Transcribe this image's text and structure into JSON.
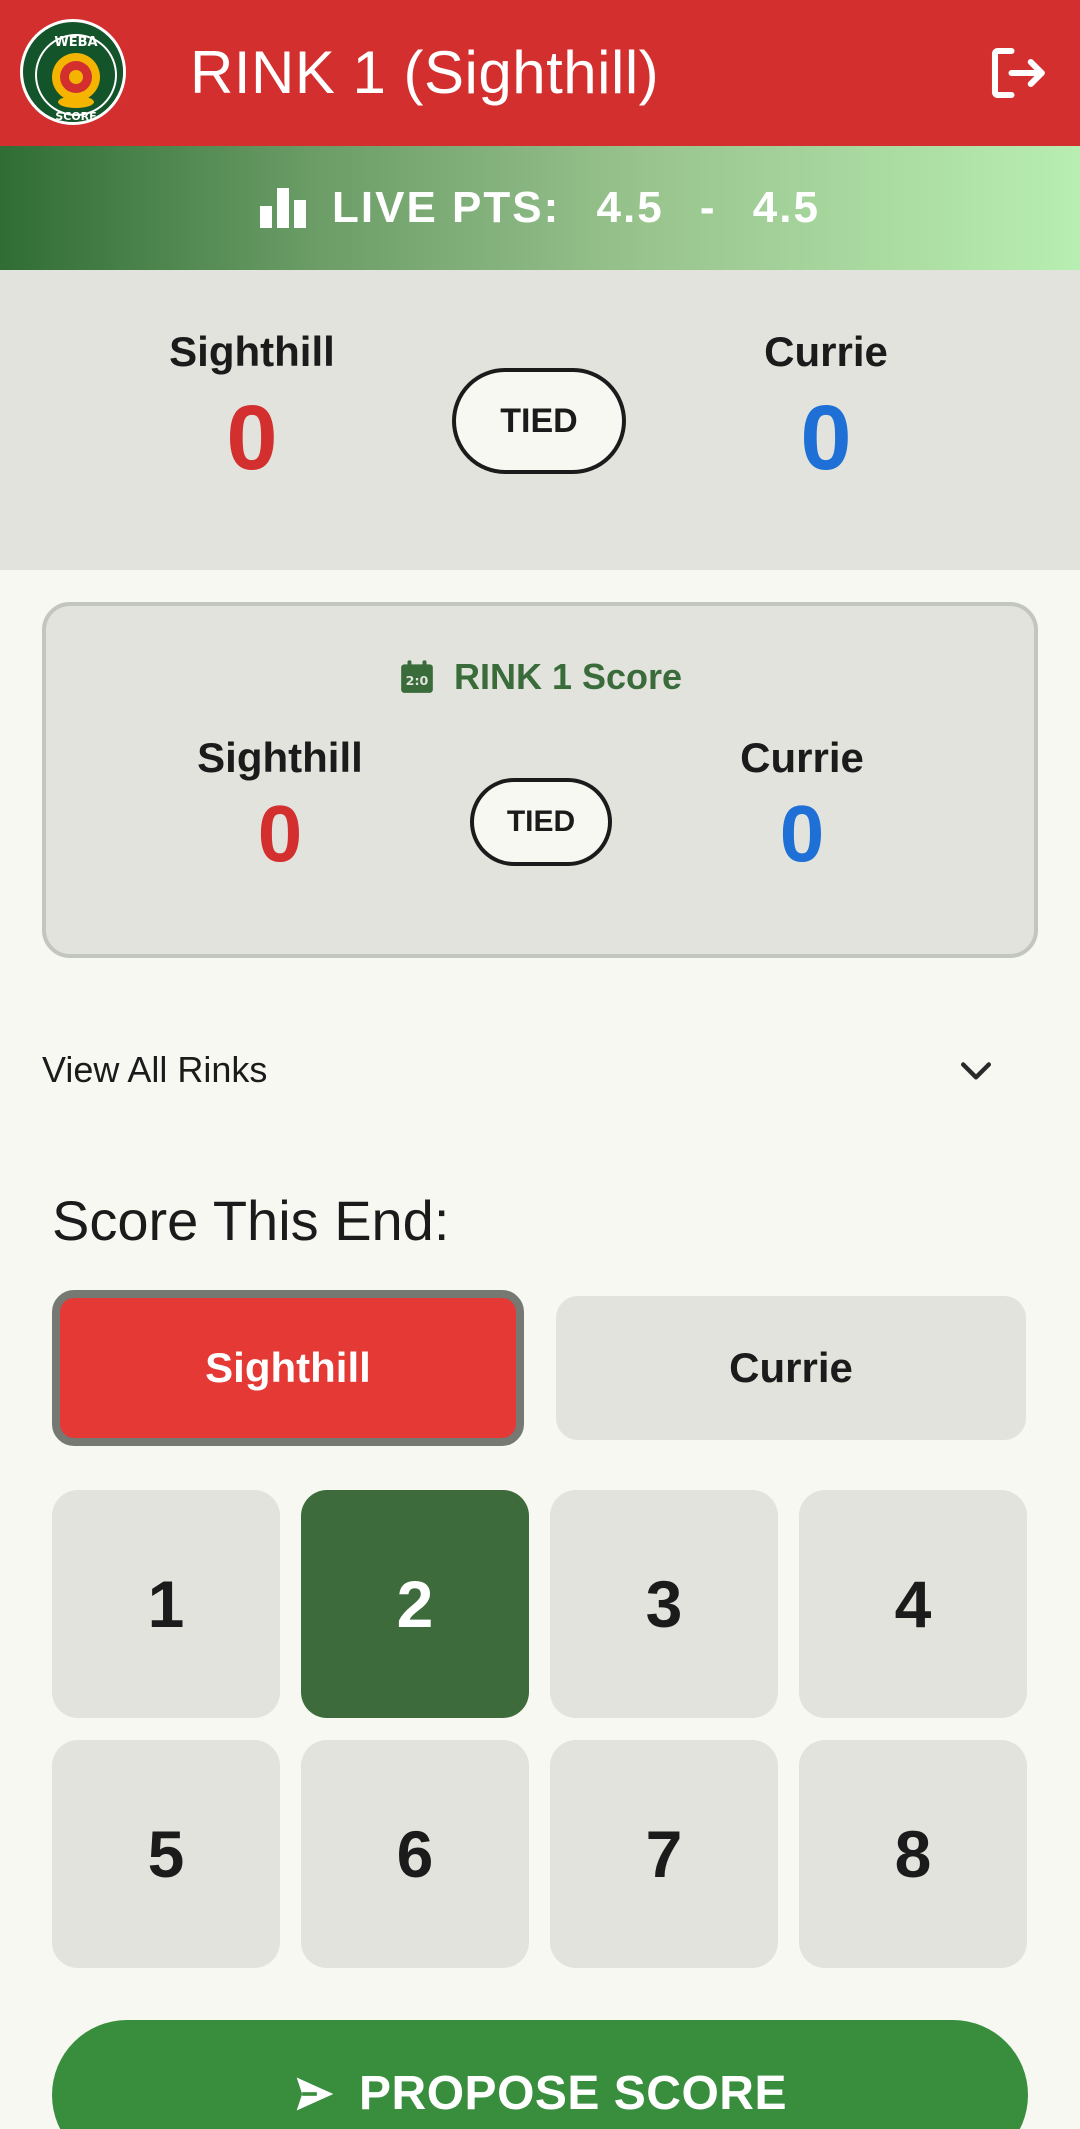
{
  "app": {
    "title": "RINK 1 (Sighthill)",
    "logo_text_top": "WEBA",
    "logo_text_bottom": "SCORE",
    "logo_icon": "bowls-logo-icon",
    "logout_icon": "logout-icon"
  },
  "live": {
    "icon": "bar-chart-icon",
    "label": "LIVE PTS:",
    "home_pts": "4.5",
    "separator": "-",
    "away_pts": "4.5"
  },
  "summary": {
    "home_name": "Sighthill",
    "home_score": "0",
    "status": "TIED",
    "away_name": "Currie",
    "away_score": "0"
  },
  "rink_card": {
    "icon": "scoreboard-icon",
    "title": "RINK 1 Score",
    "home_name": "Sighthill",
    "home_score": "0",
    "status": "TIED",
    "away_name": "Currie",
    "away_score": "0"
  },
  "view_all": {
    "label": "View All Rinks",
    "icon": "chevron-down-icon"
  },
  "score_end": {
    "title": "Score This End:",
    "teams": [
      {
        "label": "Sighthill",
        "selected": true
      },
      {
        "label": "Currie",
        "selected": false
      }
    ],
    "numbers": [
      "1",
      "2",
      "3",
      "4",
      "5",
      "6",
      "7",
      "8"
    ],
    "selected_number": "2"
  },
  "actions": {
    "propose_label": "PROPOSE SCORE",
    "propose_icon": "send-icon"
  },
  "colors": {
    "app_bar": "#d32f2f",
    "home_score": "#d32f2f",
    "away_score": "#1e6fd6",
    "accent_green": "#3d6b3b",
    "propose_green": "#388e3c"
  }
}
